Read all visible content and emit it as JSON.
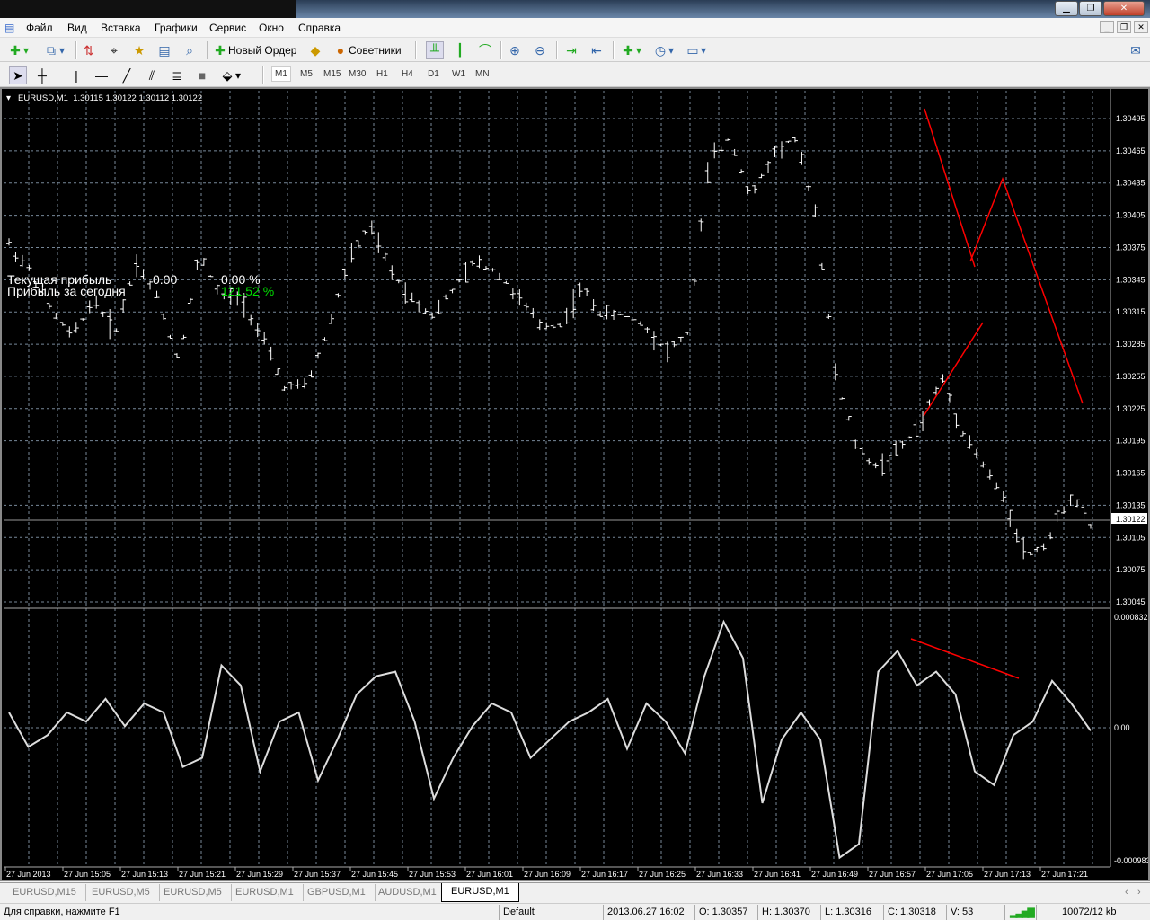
{
  "menu": [
    "Файл",
    "Вид",
    "Вставка",
    "Графики",
    "Сервис",
    "Окно",
    "Справка"
  ],
  "toolbar": {
    "new_order": "Новый Ордер",
    "advisors": "Советники"
  },
  "timeframes": [
    "M1",
    "M5",
    "M15",
    "M30",
    "H1",
    "H4",
    "D1",
    "W1",
    "MN"
  ],
  "chart": {
    "header": "EURUSD,M1  1.30115 1.30122 1.30112 1.30122",
    "current_price": "1.30122",
    "price_labels": [
      "1.30495",
      "1.30465",
      "1.30435",
      "1.30405",
      "1.30375",
      "1.30345",
      "1.30315",
      "1.30285",
      "1.30255",
      "1.30225",
      "1.30195",
      "1.30165",
      "1.30135",
      "1.30105",
      "1.30075",
      "1.30045"
    ],
    "price_range": [
      1.30045,
      1.30495
    ],
    "osc_labels": {
      "max": "0.000832",
      "zero": "0.00",
      "min": "-0.000983"
    },
    "osc_range": [
      -0.000983,
      0.000832
    ],
    "time_labels": [
      "27 Jun 2013",
      "27 Jun 15:05",
      "27 Jun 15:13",
      "27 Jun 15:21",
      "27 Jun 15:29",
      "27 Jun 15:37",
      "27 Jun 15:45",
      "27 Jun 15:53",
      "27 Jun 16:01",
      "27 Jun 16:09",
      "27 Jun 16:17",
      "27 Jun 16:25",
      "27 Jun 16:33",
      "27 Jun 16:41",
      "27 Jun 16:49",
      "27 Jun 16:57",
      "27 Jun 17:05",
      "27 Jun 17:13",
      "27 Jun 17:21"
    ],
    "price_path": [
      1.30378,
      1.30353,
      1.30316,
      1.30291,
      1.30328,
      1.30295,
      1.30362,
      1.30328,
      1.3027,
      1.3037,
      1.30328,
      1.30328,
      1.30287,
      1.30245,
      1.30245,
      1.30295,
      1.30362,
      1.30395,
      1.30353,
      1.30328,
      1.30312,
      1.30337,
      1.30362,
      1.30353,
      1.30328,
      1.30303,
      1.30303,
      1.30337,
      1.30312,
      1.30312,
      1.30303,
      1.30278,
      1.30295,
      1.30453,
      1.30478,
      1.3042,
      1.30462,
      1.30478,
      1.30412,
      1.30253,
      1.30187,
      1.3017,
      1.30187,
      1.30212,
      1.30253,
      1.30203,
      1.3017,
      1.30137,
      1.30087,
      1.30103,
      1.30145,
      1.30116
    ],
    "osc_path": [
      0.000122,
      -0.000135,
      -4.7e-05,
      0.000122,
      5.4e-05,
      0.000223,
      2e-05,
      0.000189,
      0.000122,
      -0.000284,
      -0.000216,
      0.000473,
      0.000324,
      -0.000318,
      5.4e-05,
      0.000122,
      -0.000385,
      -8.1e-05,
      0.000257,
      0.000392,
      0.000426,
      5.4e-05,
      -0.00052,
      -0.000216,
      2e-05,
      0.000189,
      0.000122,
      -0.000216,
      -8.1e-05,
      5.4e-05,
      0.000122,
      0.000223,
      -0.000149,
      0.000189,
      5.4e-05,
      -0.000183,
      0.000392,
      0.000798,
      0.000527,
      -0.000554,
      -8.1e-05,
      0.000122,
      -8.1e-05,
      -0.00096,
      -0.000859,
      0.000426,
      0.000581,
      0.000324,
      0.000426,
      0.000257,
      -0.000318,
      -0.000419,
      -4.7e-05,
      5.4e-05,
      0.000358,
      0.000189,
      -1.4e-05
    ],
    "info": {
      "current_label": "Текущая прибыль",
      "today_label": "Прибыль за сегодня",
      "current_value": "0.00",
      "current_pct": "0.00 %",
      "today_pct": "121.52 %"
    },
    "colors": {
      "bars": "#ffffff",
      "grid": "#778899",
      "lines": "#ff0000",
      "positive": "#00dd00"
    }
  },
  "tabs": [
    "EURUSD,M15",
    "EURUSD,M5",
    "EURUSD,M5",
    "EURUSD,M1",
    "GBPUSD,M1",
    "AUDUSD,M1",
    "EURUSD,M1"
  ],
  "status": {
    "help": "Для справки, нажмите F1",
    "profile": "Default",
    "datetime": "2013.06.27 16:02",
    "open": "O: 1.30357",
    "high": "H: 1.30370",
    "low": "L: 1.30316",
    "close": "C: 1.30318",
    "volume": "V: 53",
    "traffic": "10072/12 kb"
  }
}
